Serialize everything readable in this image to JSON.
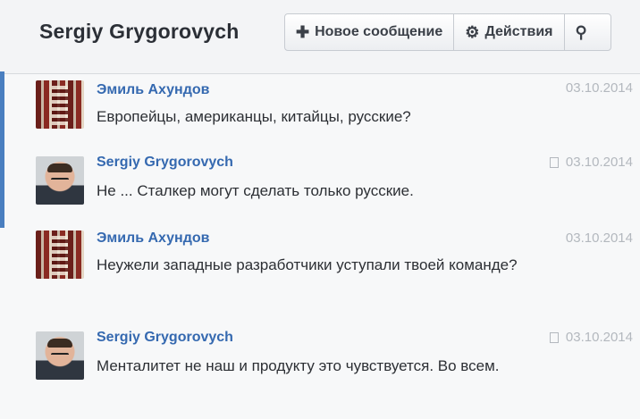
{
  "header": {
    "title": "Sergiy Grygorovych",
    "new_message_label": "Новое сообщение",
    "actions_label": "Действия"
  },
  "messages": [
    {
      "author": "Эмиль Ахундов",
      "text": "Европейцы, американцы, китайцы, русские?",
      "date": "03.10.2014",
      "avatar": "emil"
    },
    {
      "author": "Sergiy Grygorovych",
      "text": "Не ... Сталкер могут сделать только русские.",
      "date": "03.10.2014",
      "avatar": "sergiy"
    },
    {
      "author": "Эмиль Ахундов",
      "text": "Неужели западные разработчики уступали твоей команде?",
      "date": "03.10.2014",
      "avatar": "emil"
    },
    {
      "author": "Sergiy Grygorovych",
      "text": "Менталитет не наш и продукту это чувствуется. Во всем.",
      "date": "03.10.2014",
      "avatar": "sergiy"
    }
  ],
  "colors": {
    "author_link": "#3569b0",
    "date_text": "#b3b8be",
    "accent_bar": "#4a7fc0"
  },
  "icons": {
    "new_message": "plus-icon",
    "actions": "gear-icon",
    "search": "search-icon",
    "message_marker": "message-icon"
  }
}
